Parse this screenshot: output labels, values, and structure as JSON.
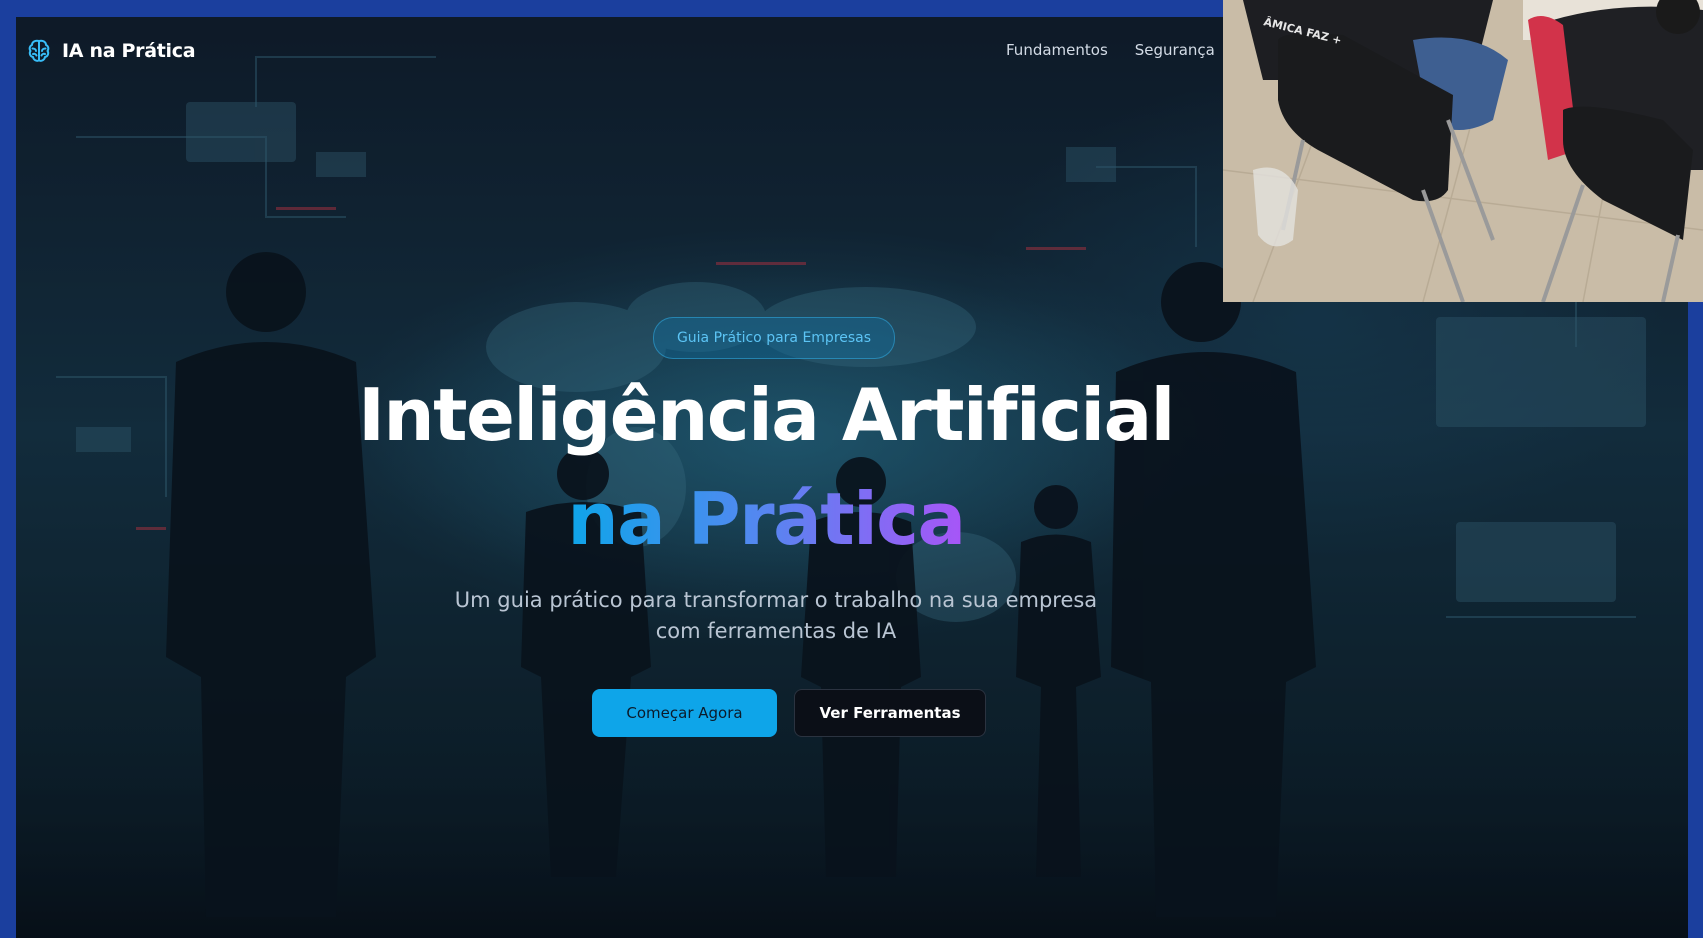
{
  "brand": {
    "name": "IA na Prática",
    "icon": "brain-icon"
  },
  "nav": {
    "links": [
      "Fundamentos",
      "Segurança"
    ]
  },
  "hero": {
    "badge": "Guia Prático para Empresas",
    "title_line1": "Inteligência Artificial",
    "title_line2": "na Prática",
    "subtitle": "Um guia prático para transformar o trabalho na sua empresa com ferramentas de IA",
    "primary_button": "Começar Agora",
    "secondary_button": "Ver Ferramentas"
  },
  "photo_overlay": {
    "shirt_text": "ÂMICA FAZ +"
  },
  "colors": {
    "outer_border": "#1b3f9e",
    "accent": "#0ea5e9",
    "gradient_start": "#0ea5e9",
    "gradient_end": "#a855f7",
    "badge_text": "#5cc4f5"
  }
}
